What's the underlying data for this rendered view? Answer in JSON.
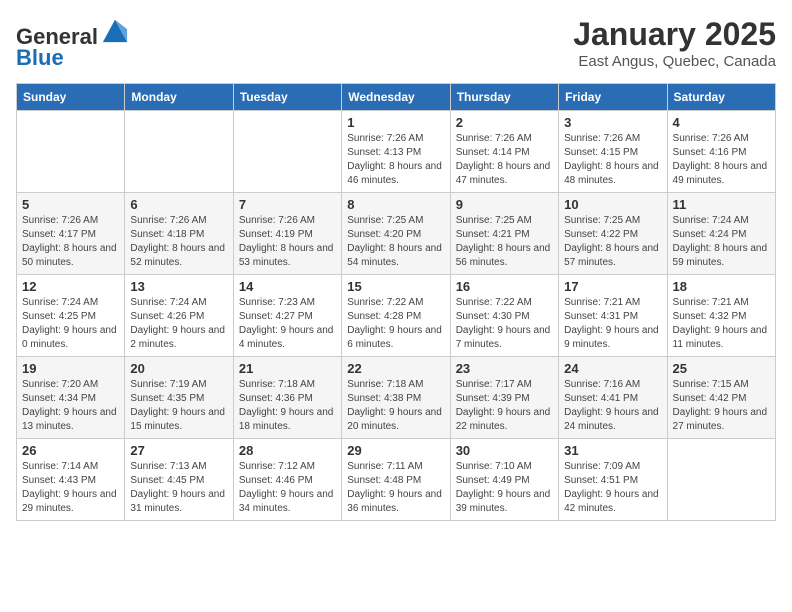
{
  "header": {
    "logo_line1": "General",
    "logo_line2": "Blue",
    "title": "January 2025",
    "subtitle": "East Angus, Quebec, Canada"
  },
  "weekdays": [
    "Sunday",
    "Monday",
    "Tuesday",
    "Wednesday",
    "Thursday",
    "Friday",
    "Saturday"
  ],
  "weeks": [
    [
      {
        "day": "",
        "detail": ""
      },
      {
        "day": "",
        "detail": ""
      },
      {
        "day": "",
        "detail": ""
      },
      {
        "day": "1",
        "detail": "Sunrise: 7:26 AM\nSunset: 4:13 PM\nDaylight: 8 hours and 46 minutes."
      },
      {
        "day": "2",
        "detail": "Sunrise: 7:26 AM\nSunset: 4:14 PM\nDaylight: 8 hours and 47 minutes."
      },
      {
        "day": "3",
        "detail": "Sunrise: 7:26 AM\nSunset: 4:15 PM\nDaylight: 8 hours and 48 minutes."
      },
      {
        "day": "4",
        "detail": "Sunrise: 7:26 AM\nSunset: 4:16 PM\nDaylight: 8 hours and 49 minutes."
      }
    ],
    [
      {
        "day": "5",
        "detail": "Sunrise: 7:26 AM\nSunset: 4:17 PM\nDaylight: 8 hours and 50 minutes."
      },
      {
        "day": "6",
        "detail": "Sunrise: 7:26 AM\nSunset: 4:18 PM\nDaylight: 8 hours and 52 minutes."
      },
      {
        "day": "7",
        "detail": "Sunrise: 7:26 AM\nSunset: 4:19 PM\nDaylight: 8 hours and 53 minutes."
      },
      {
        "day": "8",
        "detail": "Sunrise: 7:25 AM\nSunset: 4:20 PM\nDaylight: 8 hours and 54 minutes."
      },
      {
        "day": "9",
        "detail": "Sunrise: 7:25 AM\nSunset: 4:21 PM\nDaylight: 8 hours and 56 minutes."
      },
      {
        "day": "10",
        "detail": "Sunrise: 7:25 AM\nSunset: 4:22 PM\nDaylight: 8 hours and 57 minutes."
      },
      {
        "day": "11",
        "detail": "Sunrise: 7:24 AM\nSunset: 4:24 PM\nDaylight: 8 hours and 59 minutes."
      }
    ],
    [
      {
        "day": "12",
        "detail": "Sunrise: 7:24 AM\nSunset: 4:25 PM\nDaylight: 9 hours and 0 minutes."
      },
      {
        "day": "13",
        "detail": "Sunrise: 7:24 AM\nSunset: 4:26 PM\nDaylight: 9 hours and 2 minutes."
      },
      {
        "day": "14",
        "detail": "Sunrise: 7:23 AM\nSunset: 4:27 PM\nDaylight: 9 hours and 4 minutes."
      },
      {
        "day": "15",
        "detail": "Sunrise: 7:22 AM\nSunset: 4:28 PM\nDaylight: 9 hours and 6 minutes."
      },
      {
        "day": "16",
        "detail": "Sunrise: 7:22 AM\nSunset: 4:30 PM\nDaylight: 9 hours and 7 minutes."
      },
      {
        "day": "17",
        "detail": "Sunrise: 7:21 AM\nSunset: 4:31 PM\nDaylight: 9 hours and 9 minutes."
      },
      {
        "day": "18",
        "detail": "Sunrise: 7:21 AM\nSunset: 4:32 PM\nDaylight: 9 hours and 11 minutes."
      }
    ],
    [
      {
        "day": "19",
        "detail": "Sunrise: 7:20 AM\nSunset: 4:34 PM\nDaylight: 9 hours and 13 minutes."
      },
      {
        "day": "20",
        "detail": "Sunrise: 7:19 AM\nSunset: 4:35 PM\nDaylight: 9 hours and 15 minutes."
      },
      {
        "day": "21",
        "detail": "Sunrise: 7:18 AM\nSunset: 4:36 PM\nDaylight: 9 hours and 18 minutes."
      },
      {
        "day": "22",
        "detail": "Sunrise: 7:18 AM\nSunset: 4:38 PM\nDaylight: 9 hours and 20 minutes."
      },
      {
        "day": "23",
        "detail": "Sunrise: 7:17 AM\nSunset: 4:39 PM\nDaylight: 9 hours and 22 minutes."
      },
      {
        "day": "24",
        "detail": "Sunrise: 7:16 AM\nSunset: 4:41 PM\nDaylight: 9 hours and 24 minutes."
      },
      {
        "day": "25",
        "detail": "Sunrise: 7:15 AM\nSunset: 4:42 PM\nDaylight: 9 hours and 27 minutes."
      }
    ],
    [
      {
        "day": "26",
        "detail": "Sunrise: 7:14 AM\nSunset: 4:43 PM\nDaylight: 9 hours and 29 minutes."
      },
      {
        "day": "27",
        "detail": "Sunrise: 7:13 AM\nSunset: 4:45 PM\nDaylight: 9 hours and 31 minutes."
      },
      {
        "day": "28",
        "detail": "Sunrise: 7:12 AM\nSunset: 4:46 PM\nDaylight: 9 hours and 34 minutes."
      },
      {
        "day": "29",
        "detail": "Sunrise: 7:11 AM\nSunset: 4:48 PM\nDaylight: 9 hours and 36 minutes."
      },
      {
        "day": "30",
        "detail": "Sunrise: 7:10 AM\nSunset: 4:49 PM\nDaylight: 9 hours and 39 minutes."
      },
      {
        "day": "31",
        "detail": "Sunrise: 7:09 AM\nSunset: 4:51 PM\nDaylight: 9 hours and 42 minutes."
      },
      {
        "day": "",
        "detail": ""
      }
    ]
  ]
}
